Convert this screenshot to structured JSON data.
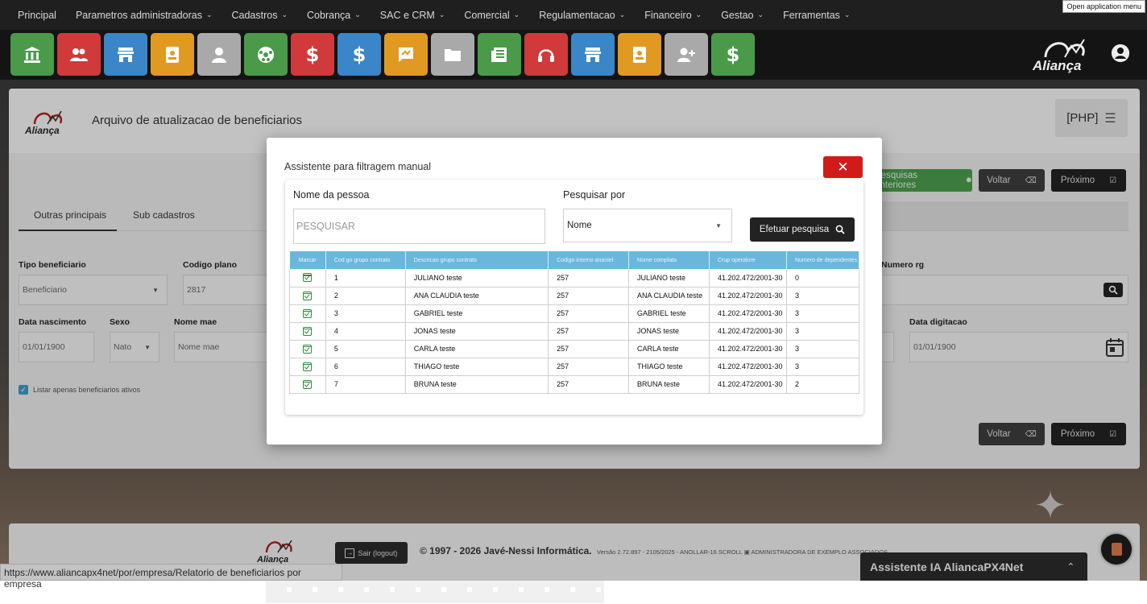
{
  "topnav": {
    "items": [
      {
        "label": "Principal",
        "chevron": false
      },
      {
        "label": "Parametros administradoras",
        "chevron": true
      },
      {
        "label": "Cadastros",
        "chevron": true
      },
      {
        "label": "Cobrança",
        "chevron": true
      },
      {
        "label": "SAC e CRM",
        "chevron": true
      },
      {
        "label": "Comercial",
        "chevron": true
      },
      {
        "label": "Regulamentacao",
        "chevron": true
      },
      {
        "label": "Financeiro",
        "chevron": true
      },
      {
        "label": "Gestao",
        "chevron": true
      },
      {
        "label": "Ferramentas",
        "chevron": true
      }
    ],
    "open_menu_label": "Open application menu"
  },
  "iconbar": {
    "tiles": [
      {
        "icon": "bank-icon",
        "color": "#4a9a4a"
      },
      {
        "icon": "users-icon",
        "color": "#d03a3a"
      },
      {
        "icon": "store-icon",
        "color": "#3a86c8"
      },
      {
        "icon": "id-badge-icon",
        "color": "#e09a22"
      },
      {
        "icon": "user-icon",
        "color": "#a9a9a9"
      },
      {
        "icon": "soccer-ball-icon",
        "color": "#4a9a4a"
      },
      {
        "icon": "dollar-icon",
        "color": "#d03a3a"
      },
      {
        "icon": "dollar-icon",
        "color": "#3a86c8"
      },
      {
        "icon": "chat-icon",
        "color": "#e09a22"
      },
      {
        "icon": "folder-icon",
        "color": "#a9a9a9"
      },
      {
        "icon": "newspaper-icon",
        "color": "#4a9a4a"
      },
      {
        "icon": "headset-icon",
        "color": "#d03a3a"
      },
      {
        "icon": "store-icon",
        "color": "#3a86c8"
      },
      {
        "icon": "id-badge-icon",
        "color": "#e09a22"
      },
      {
        "icon": "user-plus-icon",
        "color": "#a9a9a9"
      },
      {
        "icon": "dollar-icon",
        "color": "#4a9a4a"
      }
    ],
    "brand": "Aliança"
  },
  "page": {
    "title": "Arquivo de atualizacao de beneficiarios",
    "php_button": "[PHP]",
    "btn_anteriores": "Pesquisas anteriores",
    "btn_voltar": "Voltar",
    "btn_proximo": "Próximo",
    "tabs": [
      "Outras principais",
      "Sub cadastros"
    ],
    "fields": {
      "tipo_beneficiario_label": "Tipo beneficiario",
      "tipo_beneficiario_value": "Beneficiario",
      "codigo_plano_label": "Codigo plano",
      "codigo_plano_value": "2817",
      "numero_rg_label": "Numero rg",
      "data_nascimento_label": "Data nascimento",
      "data_nascimento_value": "01/01/1900",
      "sexo_label": "Sexo",
      "sexo_value": "Nato",
      "nome_mae_label": "Nome mae",
      "nome_mae_placeholder": "Nome mae",
      "data_digitacao_label": "Data digitacao",
      "data_digitacao_value": "01/01/1900"
    },
    "checkbox_label": "Listar apenas beneficiarios ativos"
  },
  "modal": {
    "title": "Assistente para filtragem manual",
    "nome_label": "Nome da pessoa",
    "search_placeholder": "PESQUISAR",
    "pesquisar_por_label": "Pesquisar por",
    "pesquisar_por_value": "Nome",
    "search_button": "Efetuar pesquisa",
    "columns": [
      "Marcar",
      "Cod go grupo contrato",
      "Descricao grupo contrato",
      "Codigo interno ananiel",
      "Nome complata",
      "Crup operalore",
      "Numero de dependentes"
    ],
    "rows": [
      [
        "1",
        "JULIANO teste",
        "257",
        "JULIANO teste",
        "41.202.472/2001-30",
        "0"
      ],
      [
        "2",
        "ANA CLAUDIA teste",
        "257",
        "ANA CLAUDIA teste",
        "41.202.472/2001-30",
        "3"
      ],
      [
        "3",
        "GABRIEL teste",
        "257",
        "GABRIEL teste",
        "41.202.472/2001-30",
        "3"
      ],
      [
        "4",
        "JONAS teste",
        "257",
        "JONAS teste",
        "41.202.472/2001-30",
        "3"
      ],
      [
        "5",
        "CARLA teste",
        "257",
        "CARLA teste",
        "41.202.472/2001-30",
        "3"
      ],
      [
        "6",
        "THIAGO teste",
        "257",
        "THIAGO teste",
        "41.202.472/2001-30",
        "3"
      ],
      [
        "7",
        "BRUNA teste",
        "257",
        "BRUNA teste",
        "41.202.472/2001-30",
        "2"
      ]
    ]
  },
  "footer": {
    "logout": "Sair (logout)",
    "copyright": "© 1997 - 2026 Javé-Nessi Informática.",
    "version": "Versão 2.72.897 - 2105/2025 - ANOLLAR-16 SCROLL ▣ ADMINISTRADORA DE EXEMPLO ASSOCIADOS",
    "status_url": "https://www.aliancapx4net/por/empresa/Relatorio de beneficiarios por empresa",
    "assistant": "Assistente IA AliancaPX4Net"
  }
}
